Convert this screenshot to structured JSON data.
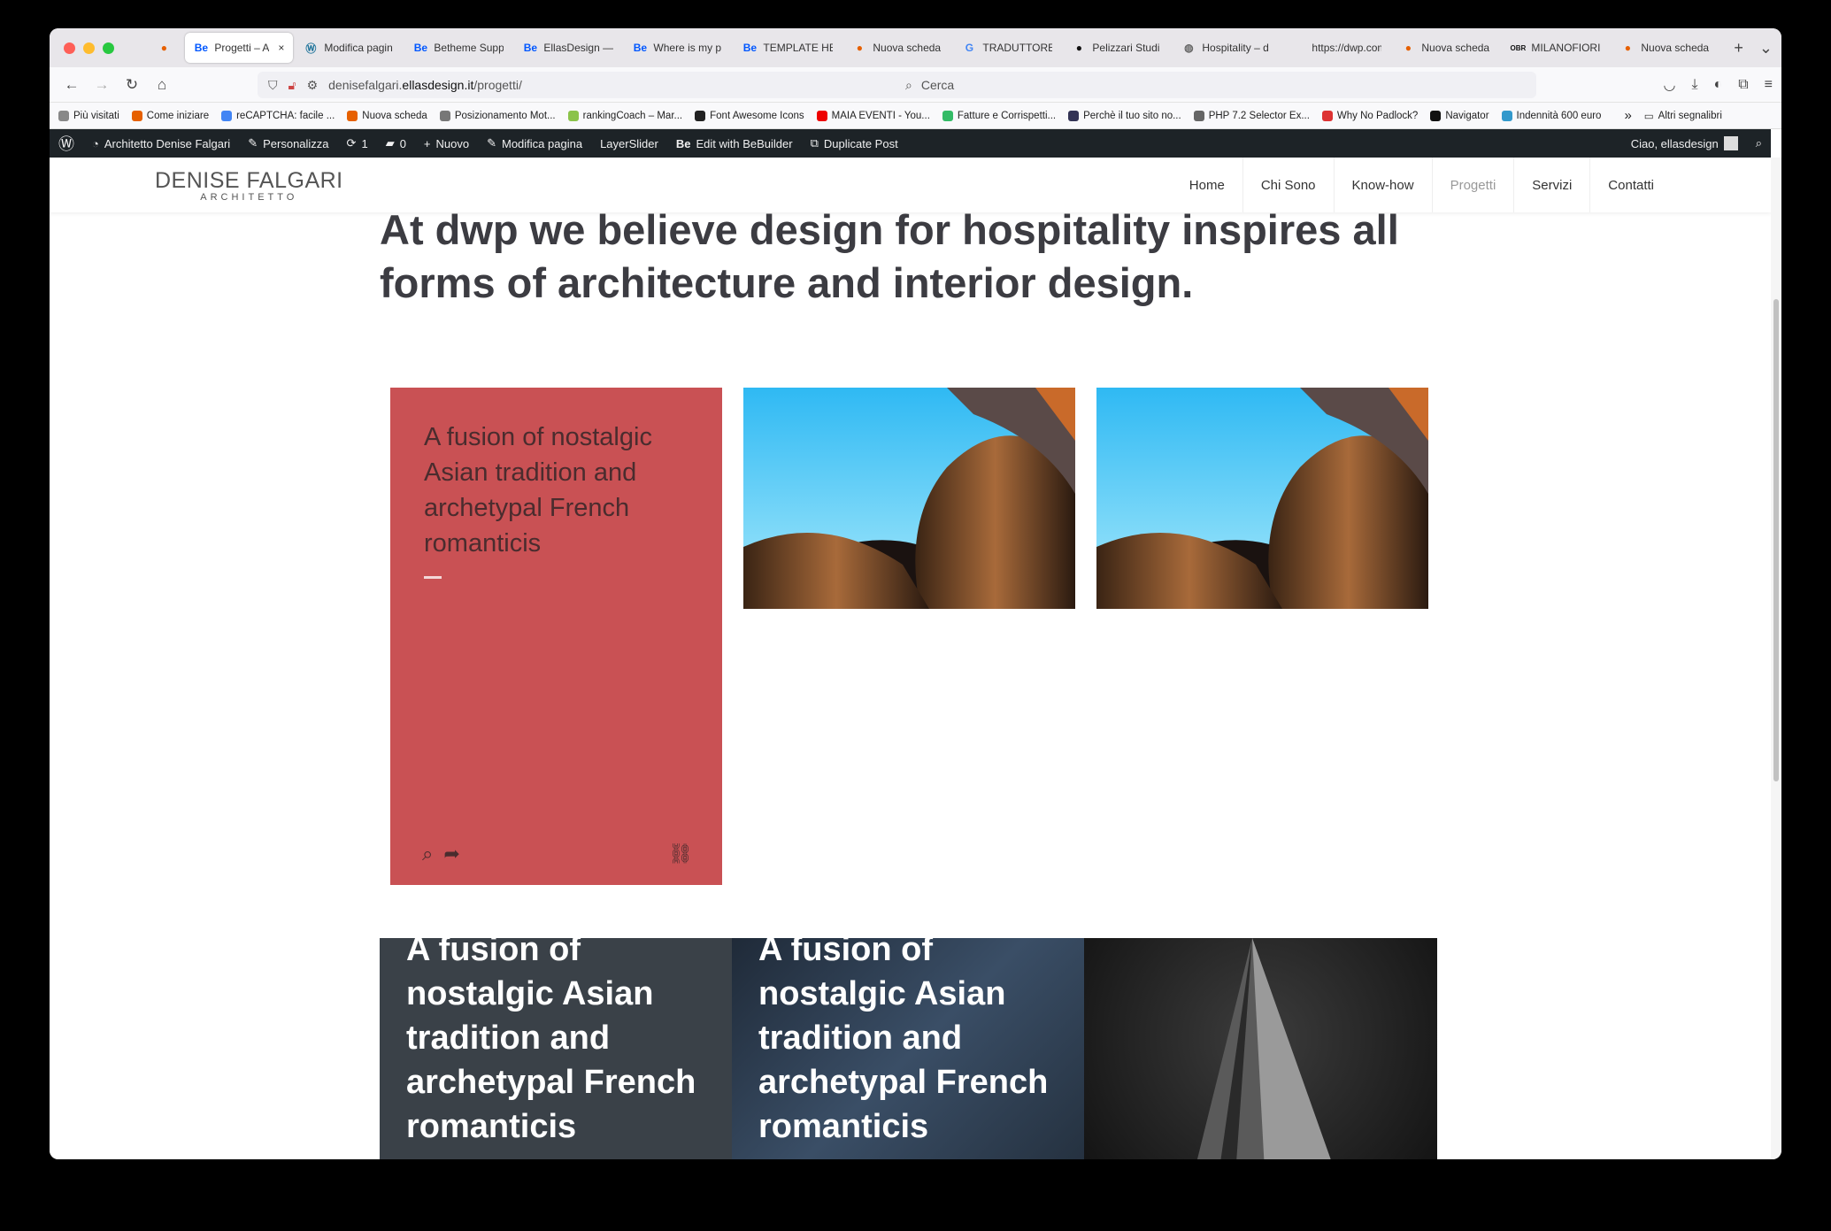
{
  "browser": {
    "tabs": [
      {
        "icon": "firefox-icon",
        "title": ""
      },
      {
        "icon": "behance-icon",
        "title": "Progetti – A"
      },
      {
        "icon": "wordpress-icon",
        "title": "Modifica pagin"
      },
      {
        "icon": "behance-icon",
        "title": "Betheme Supp"
      },
      {
        "icon": "behance-icon",
        "title": "EllasDesign —"
      },
      {
        "icon": "behance-icon",
        "title": "Where is my p"
      },
      {
        "icon": "behance-icon",
        "title": "TEMPLATE HE"
      },
      {
        "icon": "firefox-icon",
        "title": "Nuova scheda"
      },
      {
        "icon": "google-icon",
        "title": "TRADUTTORE"
      },
      {
        "icon": "circle-icon",
        "title": "Pelizzari Studi"
      },
      {
        "icon": "globe-icon",
        "title": "Hospitality – d"
      },
      {
        "icon": "blank-icon",
        "title": "https://dwp.com/ill"
      },
      {
        "icon": "firefox-icon",
        "title": "Nuova scheda"
      },
      {
        "icon": "obr-icon",
        "title": "MILANOFIORI"
      },
      {
        "icon": "firefox-icon",
        "title": "Nuova scheda"
      }
    ],
    "active_tab_close": "×",
    "new_tab": "+",
    "tab_list": "⌄",
    "url_prefix": "denisefalgari.",
    "url_host": "ellasdesign.it",
    "url_path": "/progetti/",
    "search_placeholder": "Cerca",
    "bookmarks": [
      {
        "label": "Più visitati",
        "color": "#888"
      },
      {
        "label": "Come iniziare",
        "color": "#e66000"
      },
      {
        "label": "reCAPTCHA: facile ...",
        "color": "#4285f4"
      },
      {
        "label": "Nuova scheda",
        "color": "#e66000"
      },
      {
        "label": "Posizionamento Mot...",
        "color": "#777"
      },
      {
        "label": "rankingCoach – Mar...",
        "color": "#8bc34a"
      },
      {
        "label": "Font Awesome Icons",
        "color": "#222"
      },
      {
        "label": "MAIA EVENTI - You...",
        "color": "#e00"
      },
      {
        "label": "Fatture e Corrispetti...",
        "color": "#3b6"
      },
      {
        "label": "Perchè il tuo sito no...",
        "color": "#335"
      },
      {
        "label": "PHP 7.2 Selector Ex...",
        "color": "#666"
      },
      {
        "label": "Why No Padlock?",
        "color": "#d33"
      },
      {
        "label": "Navigator",
        "color": "#111"
      },
      {
        "label": "Indennità 600 euro",
        "color": "#39c"
      }
    ],
    "bookmarks_more": "»",
    "bookmarks_other": "Altri segnalibri"
  },
  "wp_admin": {
    "site_name": "Architetto Denise Falgari",
    "customize": "Personalizza",
    "updates": "1",
    "comments": "0",
    "new": "Nuovo",
    "edit_page": "Modifica pagina",
    "layerslider": "LayerSlider",
    "bebuilder": "Edit with BeBuilder",
    "duplicate": "Duplicate Post",
    "greeting": "Ciao, ellasdesign"
  },
  "site": {
    "logo_name": "DENISE FALGARI",
    "logo_sub": "ARCHITETTO",
    "menu": [
      "Home",
      "Chi Sono",
      "Know-how",
      "Progetti",
      "Servizi",
      "Contatti"
    ],
    "current_menu": "Progetti",
    "headline": "At dwp we believe design for hospitality inspires all forms of architecture and interior design.",
    "red_card_text": "A fusion of nostalgic Asian tradition and archetypal French romanticis",
    "bottom_card_1_text": "A fusion of nostalgic Asian tradition and archetypal French romanticis",
    "bottom_card_2_text": "A fusion of nostalgic Asian tradition and archetypal French romanticis",
    "colors": {
      "red_card": "#c95154",
      "wp_bar": "#1d2327",
      "headline": "#3c3c42"
    }
  }
}
